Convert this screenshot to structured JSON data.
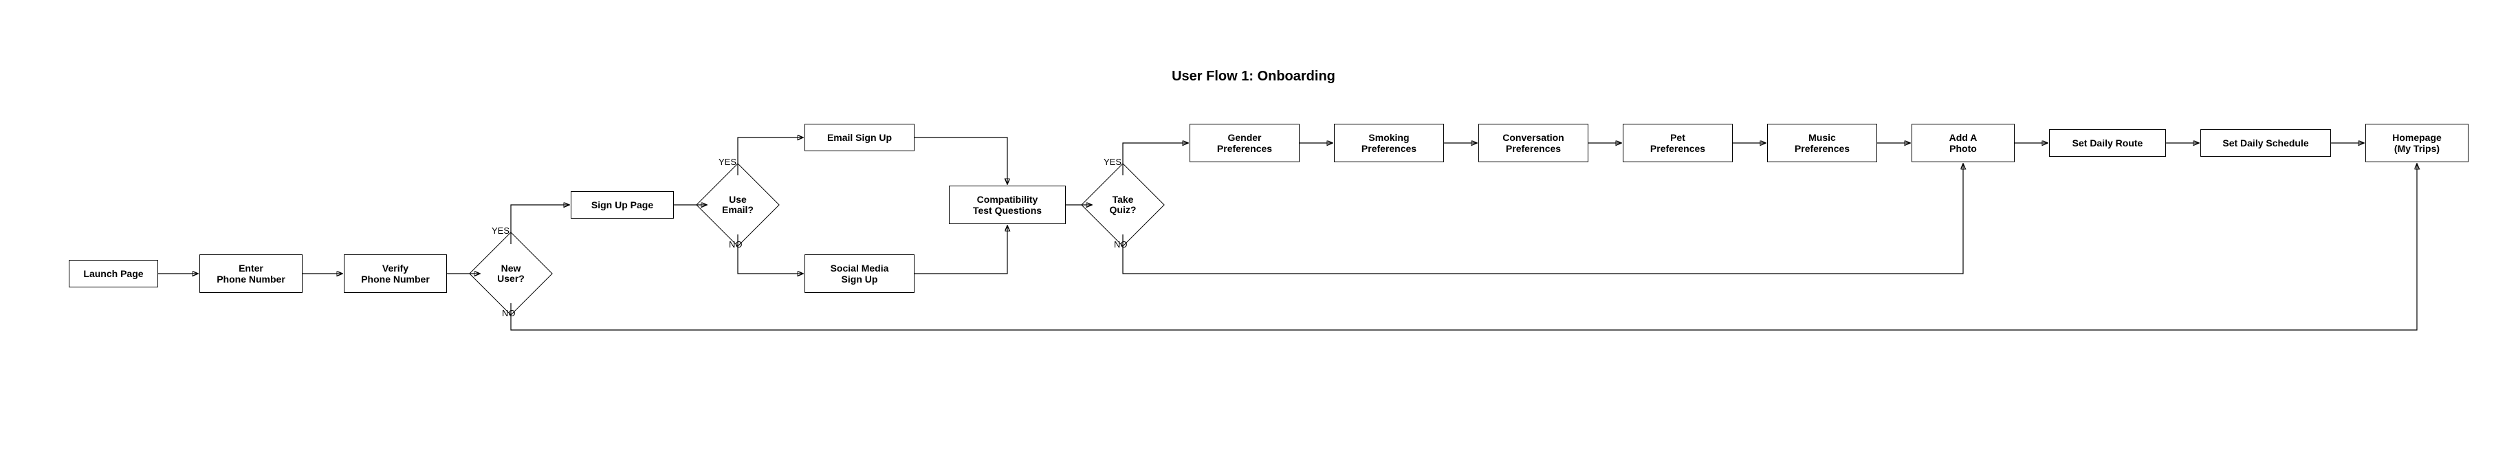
{
  "title": "User Flow 1: Onboarding",
  "nodes": {
    "launch": "Launch Page",
    "enter_phone": "Enter\nPhone Number",
    "verify_phone": "Verify\nPhone Number",
    "new_user": "New\nUser?",
    "sign_up_page": "Sign Up Page",
    "use_email": "Use\nEmail?",
    "email_signup": "Email Sign Up",
    "social_signup": "Social Media\nSign Up",
    "compat": "Compatibility\nTest Questions",
    "take_quiz": "Take Quiz?",
    "gender": "Gender\nPreferences",
    "smoking": "Smoking\nPreferences",
    "conversation": "Conversation\nPreferences",
    "pet": "Pet\nPreferences",
    "music": "Music\nPreferences",
    "add_photo": "Add A\nPhoto",
    "daily_route": "Set Daily Route",
    "daily_schedule": "Set Daily Schedule",
    "homepage": "Homepage\n(My Trips)"
  },
  "labels": {
    "yes": "YES",
    "no": "NO"
  }
}
